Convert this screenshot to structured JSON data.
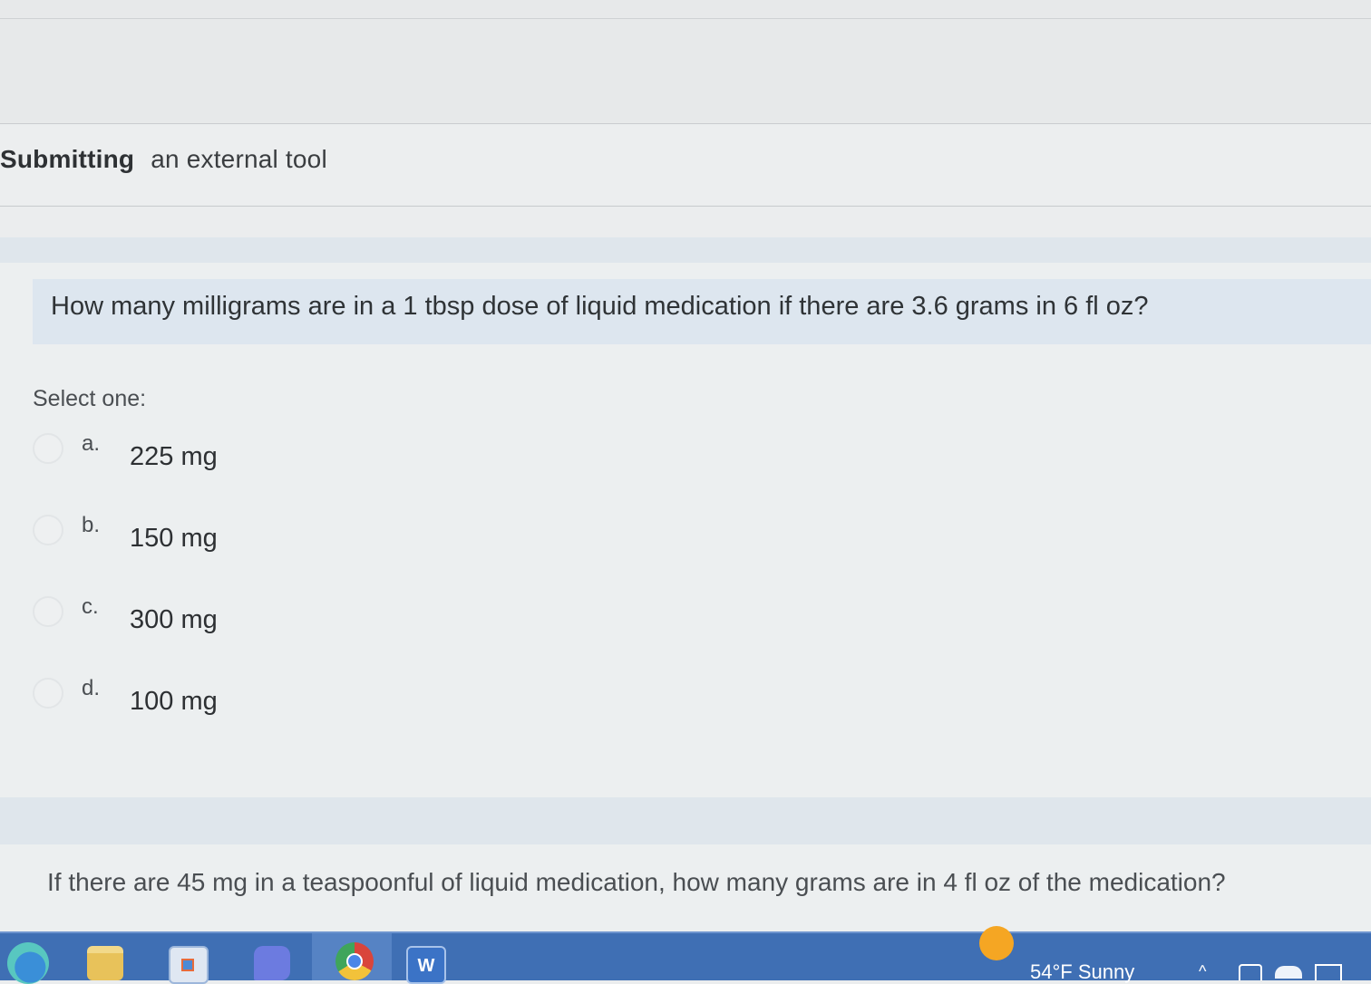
{
  "header": {
    "title_strong": "Submitting",
    "title_rest": "an external tool"
  },
  "question1": {
    "text": "How many milligrams are in a 1 tbsp dose of liquid medication if there are 3.6 grams in 6 fl oz?",
    "prompt": "Select one:",
    "options": [
      {
        "letter": "a.",
        "answer": "225 mg"
      },
      {
        "letter": "b.",
        "answer": "150 mg"
      },
      {
        "letter": "c.",
        "answer": "300 mg"
      },
      {
        "letter": "d.",
        "answer": "100 mg"
      }
    ]
  },
  "question2": {
    "text": "If there are 45 mg in a teaspoonful of liquid medication, how many grams are in 4 fl oz of the medication?"
  },
  "taskbar": {
    "apps": [
      "edge-icon",
      "file-explorer-icon",
      "store-icon",
      "chat-icon",
      "chrome-icon",
      "word-icon"
    ],
    "word_label": "W",
    "weather": "54°F  Sunny",
    "chevron": "^"
  },
  "colors": {
    "taskbar": "#3f6fb4",
    "question_box": "#dde6ef",
    "page_bg": "#eceff0"
  }
}
